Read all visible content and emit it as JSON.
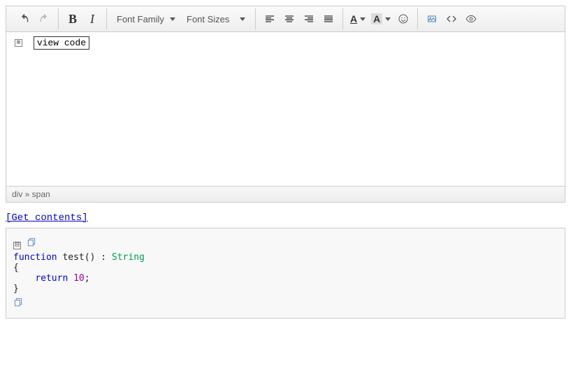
{
  "toolbar": {
    "font_family_label": "Font Family",
    "font_sizes_label": "Font Sizes",
    "bold_glyph": "B",
    "italic_glyph": "I",
    "color_glyph": "A",
    "highlight_glyph": "A"
  },
  "content": {
    "expand_glyph": "⊞",
    "view_code_label": "view code"
  },
  "status": {
    "path": "div » span"
  },
  "link": {
    "get_contents": "[Get contents]"
  },
  "output": {
    "collapse_glyph": "⊟",
    "code": {
      "kw_function": "function",
      "fname": " test() : ",
      "cls_string": "String",
      "open": "{",
      "kw_return": "return",
      "num": "10",
      "semi": ";",
      "close": "}"
    }
  }
}
